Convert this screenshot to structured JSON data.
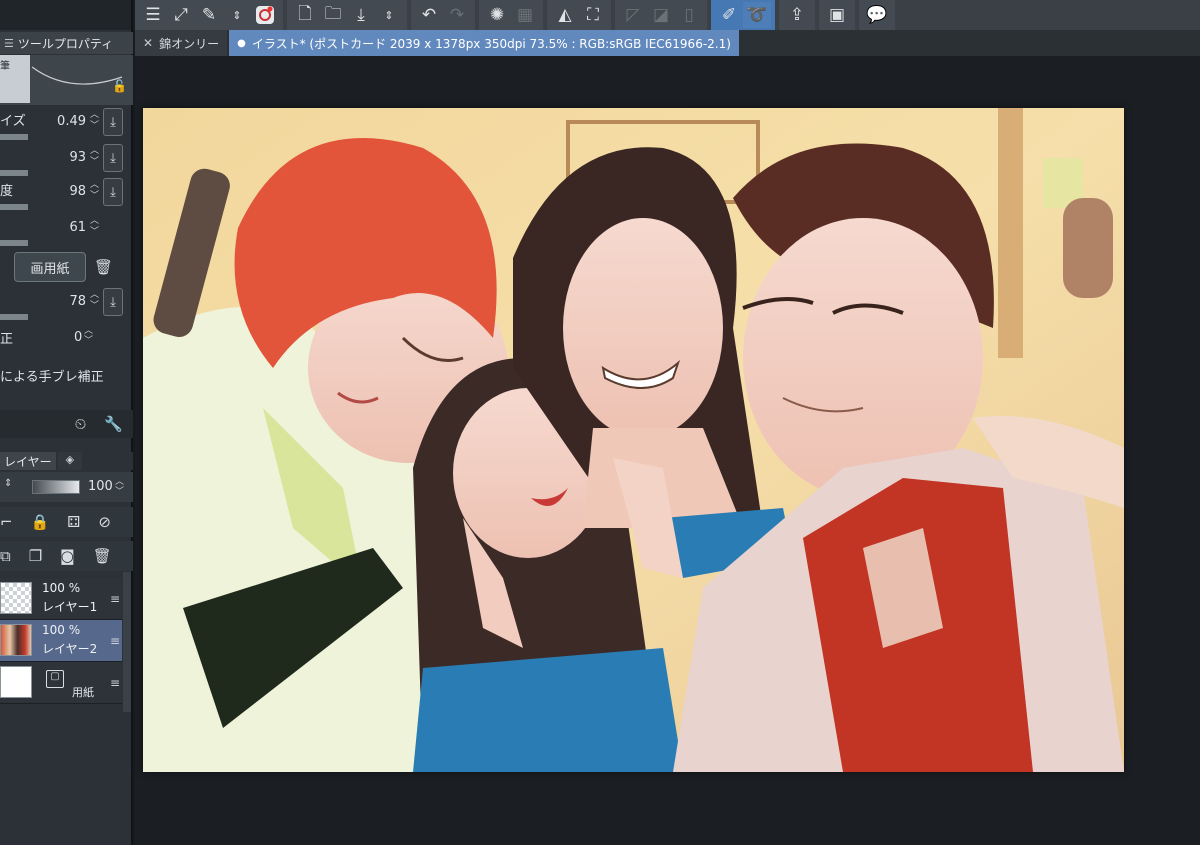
{
  "toolbar": {
    "buttons": [
      "menu-icon",
      "fit-icon",
      "transform-icon",
      "up-down-icon",
      "spiral-icon",
      "new-layer-icon",
      "folder-icon",
      "download-icon",
      "up-down-icon",
      "undo-icon",
      "redo-icon",
      "loading-icon",
      "erase-icon",
      "fill-icon",
      "select-icon",
      "brush-icon",
      "lasso-icon",
      "export-icon",
      "tablet-icon",
      "help-icon"
    ]
  },
  "tabs": [
    {
      "label": "錦オンリー",
      "active": false
    },
    {
      "label": "イラスト* (ポストカード 2039 x 1378px 350dpi 73.5% : RGB:sRGB IEC61966-2.1)",
      "active": true
    }
  ],
  "tool_property": {
    "header": "ツールプロパティ",
    "swatch_label": "筆",
    "rows": [
      {
        "label": "イズ",
        "value": "0.49",
        "has_download": true
      },
      {
        "label": "",
        "value": "93",
        "has_download": true
      },
      {
        "label": "度",
        "value": "98",
        "has_download": true
      },
      {
        "label": "",
        "value": "61",
        "has_download": false
      }
    ],
    "paper_button": "画用紙",
    "row_after_paper": {
      "label": "",
      "value": "78",
      "has_download": true
    },
    "correction_label": "正",
    "correction_value": "0",
    "stabilization_label": "による手ブレ補正"
  },
  "layer_panel": {
    "tab_label": "レイヤー",
    "opacity_value": "100",
    "layers": [
      {
        "percent": "100 %",
        "name": "レイヤー1",
        "selected": false
      },
      {
        "percent": "100 %",
        "name": "レイヤー2",
        "selected": true
      },
      {
        "percent": "",
        "name": "用紙",
        "selected": false
      }
    ]
  }
}
